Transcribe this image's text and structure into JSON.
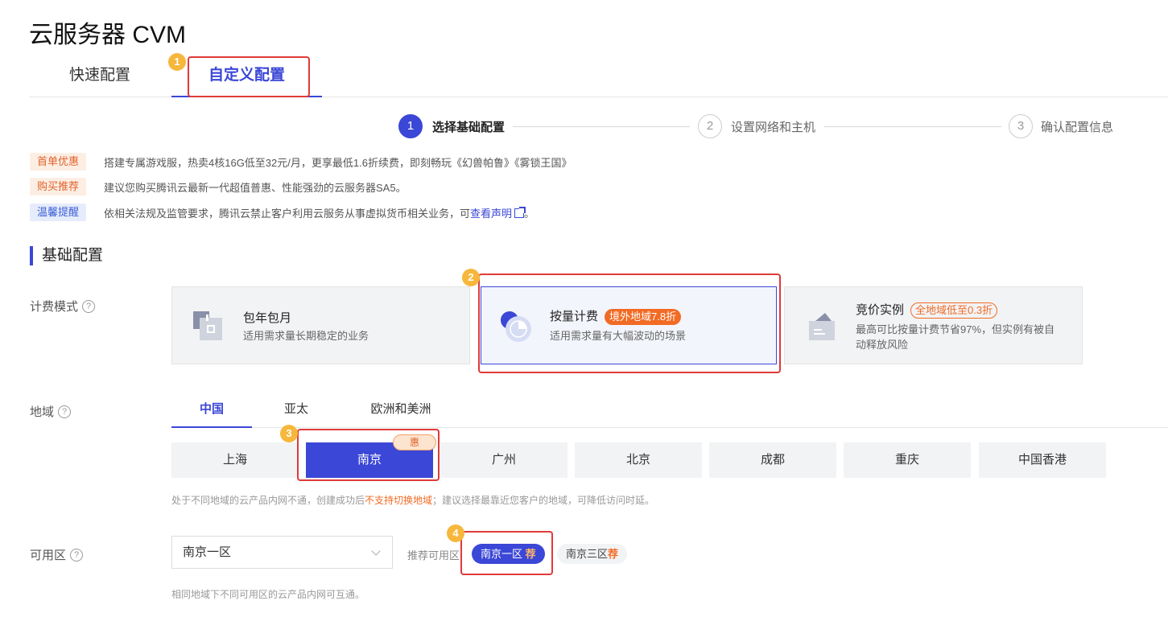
{
  "page_title": "云服务器 CVM",
  "tabs": [
    {
      "label": "快速配置",
      "active": false
    },
    {
      "label": "自定义配置",
      "active": true
    }
  ],
  "markers": [
    "1",
    "2",
    "3",
    "4"
  ],
  "steps": [
    {
      "number": "1",
      "label": "选择基础配置",
      "active": true
    },
    {
      "number": "2",
      "label": "设置网络和主机",
      "active": false
    },
    {
      "number": "3",
      "label": "确认配置信息",
      "active": false
    }
  ],
  "notices": [
    {
      "tag": "首单优惠",
      "text": "搭建专属游戏服，热卖4核16G低至32元/月，更享最低1.6折续费，即刻畅玩《幻兽帕鲁》《雾锁王国》"
    },
    {
      "tag": "购买推荐",
      "text": "建议您购买腾讯云最新一代超值普惠、性能强劲的云服务器SA5。"
    },
    {
      "tag": "温馨提醒",
      "text": "依相关法规及监管要求，腾讯云禁止客户利用云服务从事虚拟货币相关业务，可",
      "link": "查看声明",
      "suffix": "。"
    }
  ],
  "section_title": "基础配置",
  "billing": {
    "label": "计费模式",
    "options": [
      {
        "name": "包年包月",
        "desc": "适用需求量长期稳定的业务",
        "selected": false
      },
      {
        "name": "按量计费",
        "badge": "境外地域7.8折",
        "desc": "适用需求量有大幅波动的场景",
        "selected": true
      },
      {
        "name": "竞价实例",
        "badge": "全地域低至0.3折",
        "desc": "最高可比按量计费节省97%，但实例有被自动释放风险",
        "selected": false
      }
    ]
  },
  "region": {
    "label": "地域",
    "tabs": [
      {
        "label": "中国",
        "active": true
      },
      {
        "label": "亚太",
        "active": false
      },
      {
        "label": "欧洲和美洲",
        "active": false
      }
    ],
    "cities": [
      {
        "label": "上海",
        "selected": false
      },
      {
        "label": "南京",
        "selected": true
      },
      {
        "label": "广州",
        "selected": false
      },
      {
        "label": "北京",
        "selected": false
      },
      {
        "label": "成都",
        "selected": false
      },
      {
        "label": "重庆",
        "selected": false
      },
      {
        "label": "中国香港",
        "selected": false
      }
    ],
    "discount_badge": "惠",
    "hint_before": "处于不同地域的云产品内网不通，创建成功后",
    "hint_warn": "不支持切换地域",
    "hint_after": "；建议选择最靠近您客户的地域，可降低访问时延。"
  },
  "zone": {
    "label": "可用区",
    "selected_value": "南京一区",
    "recommend_label": "推荐可用区",
    "options": [
      {
        "label": "南京一区",
        "tag": "荐",
        "selected": true
      },
      {
        "label": "南京三区",
        "tag": "荐",
        "selected": false
      }
    ],
    "hint": "相同地域下不同可用区的云产品内网可互通。"
  },
  "colors": {
    "accent": "#3b47d6",
    "highlight": "#e03a3a",
    "marker": "#f6b73c",
    "warn": "#f26b24"
  }
}
